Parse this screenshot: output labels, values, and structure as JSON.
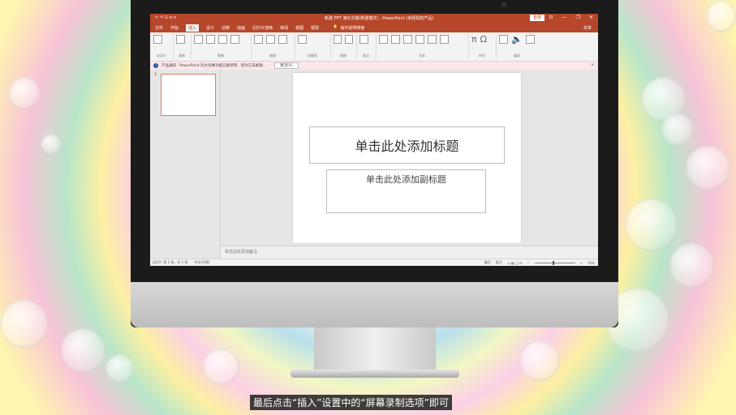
{
  "window": {
    "title": "新建 PPT 演示文稿(新建模式) - PowerPoint (未经授权产品)",
    "signin": "登录",
    "quick_access": "↶ ↷ ⊡ ⇆ ▾",
    "controls": [
      "⊡",
      "—",
      "❐",
      "✕"
    ]
  },
  "tabs": {
    "items": [
      "文件",
      "开始",
      "插入",
      "设计",
      "切换",
      "动画",
      "幻灯片放映",
      "审阅",
      "视图",
      "帮助"
    ],
    "active": "插入",
    "search_label": "操作说明搜索",
    "share_label": "共享"
  },
  "ribbon": {
    "groups": [
      "幻灯片",
      "表格",
      "图像",
      "插图",
      "加载项",
      "链接",
      "批注",
      "文本",
      "符号",
      "媒体"
    ],
    "symbols": [
      "π",
      "Ω"
    ]
  },
  "message_bar": {
    "label": "产品通知",
    "text": "PowerPoint 的大多数功能已被禁用，因为它未被激...",
    "action": "激活(A)",
    "close": "×"
  },
  "thumbnail": {
    "number": "1"
  },
  "slide": {
    "title_placeholder": "单击此处添加标题",
    "subtitle_placeholder": "单击此处添加副标题"
  },
  "notes": {
    "placeholder": "单击此处添加备注"
  },
  "status": {
    "slide_info": "幻灯片 第 1 张，共 1 张",
    "language": "中文(中国)",
    "notes_btn": "备注",
    "comments_btn": "批注",
    "zoom": "52%"
  },
  "caption": "最后点击“插入”设置中的“屏幕录制选项”即可"
}
